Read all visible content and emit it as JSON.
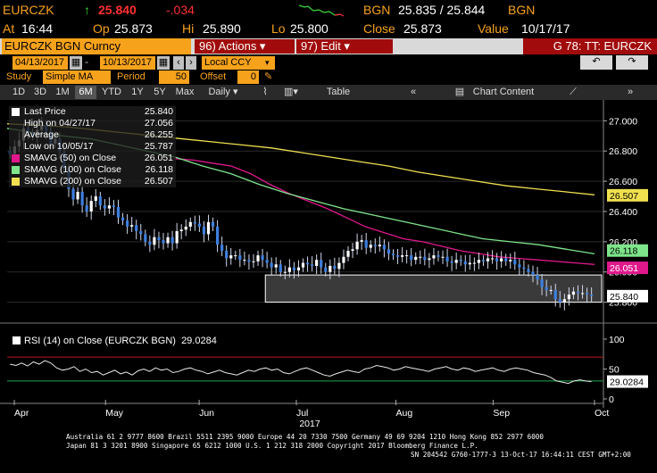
{
  "header": {
    "ticker": "EURCZK",
    "arrow": "↑",
    "last": "25.840",
    "change": "-.034",
    "bid_label": "BGN",
    "bid_ask": "25.835 / 25.844",
    "ask_label": "BGN",
    "at_label": "At",
    "at_time": "16:44",
    "op_label": "Op",
    "op_value": "25.873",
    "hi_label": "Hi",
    "hi_value": "25.890",
    "lo_label": "Lo",
    "lo_value": "25.800",
    "close_label": "Close",
    "close_value": "25.873",
    "value_label": "Value",
    "value_date": "10/17/17"
  },
  "titlebar": {
    "security": "EURCZK BGN Curncy",
    "actions": "96) Actions ▾",
    "edit": "97) Edit ▾",
    "gt": "G 78: TT: EURCZK"
  },
  "dates": {
    "start": "04/13/2017",
    "end": "10/13/2017",
    "ccy": "Local CCY"
  },
  "study": {
    "label": "Study",
    "value": "Simple MA",
    "period_label": "Period",
    "period": "50",
    "offset_label": "Offset",
    "offset": "0"
  },
  "tabs": {
    "ranges": [
      "1D",
      "3D",
      "1M",
      "6M",
      "YTD",
      "1Y",
      "5Y",
      "Max"
    ],
    "active": "6M",
    "freq": "Daily ▾",
    "table": "Table",
    "chart_content": "Chart Content"
  },
  "legend": {
    "items": [
      {
        "label": "Last Price",
        "value": "25.840",
        "color": "#ffffff"
      },
      {
        "label": "High on 04/27/17",
        "value": "27.056",
        "color": ""
      },
      {
        "label": "Average",
        "value": "26.255",
        "color": ""
      },
      {
        "label": "Low on 10/05/17",
        "value": "25.787",
        "color": ""
      },
      {
        "label": "SMAVG (50) on Close",
        "value": "26.051",
        "color": "#e0188c"
      },
      {
        "label": "SMAVG (100) on Close",
        "value": "26.118",
        "color": "#7ee58a"
      },
      {
        "label": "SMAVG (200) on Close",
        "value": "26.507",
        "color": "#f0e050"
      }
    ]
  },
  "rsi": {
    "label": "RSI (14) on Close (EURCZK BGN)",
    "value": "29.0284"
  },
  "chart_data": {
    "type": "line",
    "series": [
      {
        "name": "Last Price",
        "color": "#3d7fe0",
        "values": [
          26.78,
          26.83,
          26.87,
          26.95,
          26.92,
          26.9,
          26.94,
          26.97,
          26.93,
          26.85,
          26.88,
          26.8,
          26.68,
          26.55,
          26.48,
          26.53,
          26.44,
          26.4,
          26.47,
          26.5,
          26.44,
          26.42,
          26.44,
          26.43,
          26.36,
          26.34,
          26.3,
          26.31,
          26.27,
          26.25,
          26.2,
          26.18,
          26.23,
          26.21,
          26.19,
          26.23,
          26.19,
          26.27,
          26.28,
          26.3,
          26.33,
          26.32,
          26.3,
          26.25,
          26.33,
          26.3,
          26.18,
          26.14,
          26.09,
          26.11,
          26.11,
          26.08,
          26.08,
          26.07,
          26.07,
          26.11,
          26.08,
          26.06,
          26.03,
          26.05,
          26.0,
          26.0,
          26.03,
          26.01,
          26.03,
          26.06,
          26.05,
          26.04,
          26.08,
          26.03,
          26.0,
          26.04,
          26.02,
          26.06,
          26.1,
          26.14,
          26.15,
          26.2,
          26.21,
          26.16,
          26.18,
          26.17,
          26.18,
          26.15,
          26.12,
          26.11,
          26.1,
          26.11,
          26.11,
          26.08,
          26.1,
          26.1,
          26.08,
          26.09,
          26.11,
          26.1,
          26.1,
          26.07,
          26.06,
          26.08,
          26.07,
          26.05,
          26.06,
          26.06,
          26.08,
          26.07,
          26.09,
          26.09,
          26.07,
          26.09,
          26.07,
          26.08,
          26.05,
          26.03,
          26.02,
          26.0,
          25.98,
          25.95,
          25.9,
          25.88,
          25.88,
          25.82,
          25.8,
          25.82,
          25.85,
          25.87,
          25.86,
          25.86,
          25.85,
          25.84
        ]
      },
      {
        "name": "SMAVG (50) on Close",
        "color": "#e0188c",
        "values": [
          26.75,
          26.74,
          26.72,
          26.7,
          26.65,
          26.58,
          26.52,
          26.47,
          26.42,
          26.36,
          26.3,
          26.26,
          26.22,
          26.2,
          26.17,
          26.14,
          26.12,
          26.1,
          26.09,
          26.08,
          26.07,
          26.06,
          26.05
        ]
      },
      {
        "name": "SMAVG (100) on Close",
        "color": "#7ee58a",
        "values": [
          26.95,
          26.92,
          26.9,
          26.88,
          26.84,
          26.8,
          26.76,
          26.7,
          26.65,
          26.58,
          26.52,
          26.47,
          26.42,
          26.38,
          26.34,
          26.3,
          26.26,
          26.22,
          26.2,
          26.18,
          26.15,
          26.12
        ]
      },
      {
        "name": "SMAVG (200) on Close",
        "color": "#f0e050",
        "values": [
          26.98,
          26.97,
          26.96,
          26.94,
          26.92,
          26.9,
          26.88,
          26.86,
          26.84,
          26.82,
          26.79,
          26.76,
          26.73,
          26.7,
          26.66,
          26.63,
          26.6,
          26.57,
          26.55,
          26.53,
          26.51
        ]
      }
    ],
    "rsi_values": [
      58,
      56,
      60,
      55,
      62,
      58,
      64,
      60,
      52,
      48,
      50,
      54,
      46,
      50,
      44,
      46,
      40,
      44,
      48,
      42,
      45,
      40,
      47,
      50,
      46,
      52,
      48,
      50,
      44,
      46,
      50,
      52,
      48,
      46,
      42,
      45,
      48,
      44,
      42,
      40,
      44,
      48,
      46,
      50,
      52,
      48,
      50,
      44,
      42,
      46,
      50,
      52,
      48,
      44,
      40,
      38,
      42,
      45,
      48,
      46,
      44,
      50,
      52,
      56,
      54,
      52,
      48,
      50,
      54,
      52,
      50,
      48,
      46,
      50,
      52,
      54,
      50,
      48,
      52,
      50,
      46,
      48,
      50,
      52,
      48,
      46,
      50,
      52,
      50,
      48,
      44,
      42,
      40,
      36,
      30,
      28,
      26,
      30,
      32,
      30,
      29
    ],
    "xlabel": "2017",
    "x_ticks": [
      "Apr",
      "May",
      "Jun",
      "Jul",
      "Aug",
      "Sep",
      "Oct"
    ],
    "y_ticks": [
      "27.000",
      "26.800",
      "26.600",
      "26.400",
      "26.200",
      "26.000",
      "25.800"
    ],
    "ylim": [
      25.78,
      27.12
    ],
    "rsi_ticks": [
      "100",
      "50",
      "0"
    ],
    "rsi_levels": [
      70,
      30
    ],
    "right_labels": [
      {
        "value": "26.507",
        "bg": "#f0e050",
        "fg": "#000000"
      },
      {
        "value": "26.118",
        "bg": "#7ee58a",
        "fg": "#000000"
      },
      {
        "value": "26.051",
        "bg": "#e0188c",
        "fg": "#ffffff"
      },
      {
        "value": "25.840",
        "bg": "#ffffff",
        "fg": "#000000"
      },
      {
        "value": "29.0284",
        "bg": "#ffffff",
        "fg": "#000000"
      }
    ]
  },
  "footer": {
    "line1": "Australia 61 2 9777 8600 Brazil 5511 2395 9000 Europe 44 20 7330 7500 Germany 49 69 9204 1210 Hong Kong 852 2977 6000",
    "line2": "Japan 81 3 3201 8900          Singapore 65 6212 1000          U.S. 1 212 318 2000          Copyright 2017 Bloomberg Finance L.P.",
    "line3": "SN 204542 G760-1777-3 13-Oct-17 16:44:11 CEST GMT+2:00"
  }
}
